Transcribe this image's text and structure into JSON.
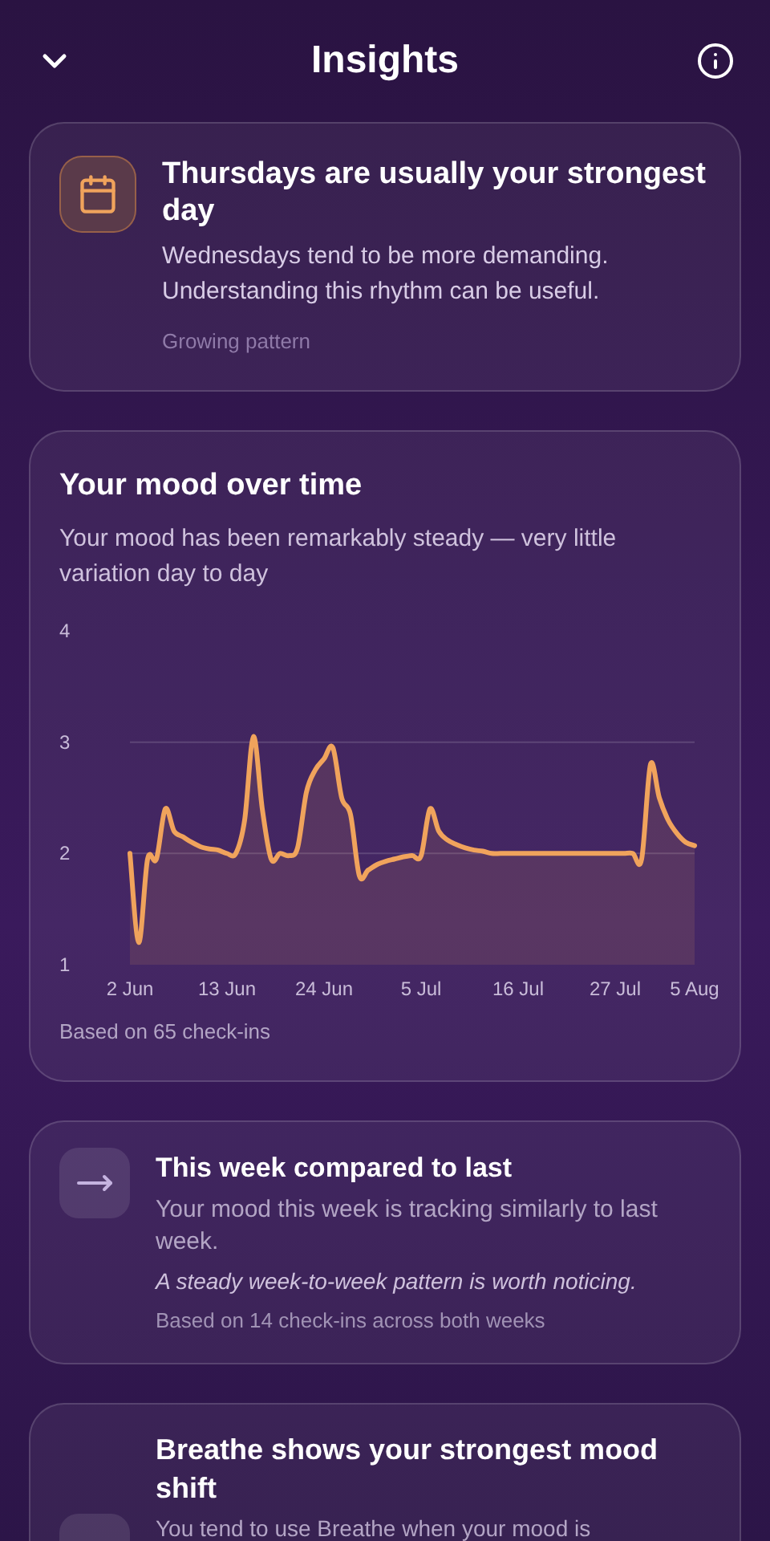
{
  "header": {
    "title": "Insights"
  },
  "pattern_card": {
    "title": "Thursdays are usually your strongest day",
    "body": "Wednesdays tend to be more demanding. Understanding this rhythm can be useful.",
    "tag": "Growing pattern"
  },
  "mood_card": {
    "title": "Your mood over time",
    "subtitle": "Your mood has been remarkably steady — very little variation day to day",
    "footnote": "Based on 65 check-ins",
    "chart_data": {
      "type": "area",
      "categories": [
        "2 Jun",
        null,
        null,
        null,
        null,
        null,
        null,
        null,
        null,
        null,
        null,
        "13 Jun",
        null,
        null,
        null,
        null,
        null,
        null,
        null,
        null,
        null,
        null,
        "24 Jun",
        null,
        null,
        null,
        null,
        null,
        null,
        null,
        null,
        null,
        null,
        "5 Jul",
        null,
        null,
        null,
        null,
        null,
        null,
        null,
        null,
        null,
        null,
        "16 Jul",
        null,
        null,
        null,
        null,
        null,
        null,
        null,
        null,
        null,
        null,
        "27 Jul",
        null,
        null,
        null,
        null,
        null,
        null,
        null,
        null,
        "5 Aug"
      ],
      "series": [
        {
          "color": "#f0a35c",
          "values": [
            2.0,
            1.2,
            1.95,
            1.95,
            2.4,
            2.2,
            2.15,
            2.1,
            2.06,
            2.04,
            2.03,
            2.0,
            2.0,
            2.3,
            3.05,
            2.4,
            1.95,
            2.0,
            1.98,
            2.05,
            2.55,
            2.75,
            2.85,
            2.95,
            2.5,
            2.35,
            1.8,
            1.85,
            1.9,
            1.93,
            1.95,
            1.97,
            1.98,
            1.98,
            2.4,
            2.2,
            2.12,
            2.08,
            2.05,
            2.03,
            2.02,
            2.0,
            2.0,
            2.0,
            2.0,
            2.0,
            2.0,
            2.0,
            2.0,
            2.0,
            2.0,
            2.0,
            2.0,
            2.0,
            2.0,
            2.0,
            2.0,
            2.0,
            1.95,
            2.8,
            2.5,
            2.3,
            2.18,
            2.1,
            2.07
          ]
        }
      ],
      "ylim": [
        1,
        4
      ],
      "yticks": [
        1,
        2,
        3,
        4
      ]
    }
  },
  "compare_card": {
    "title": "This week compared to last",
    "body": "Your mood this week is tracking similarly to last week.",
    "note": "A steady week-to-week pattern is worth noticing.",
    "footnote": "Based on 14 check-ins across both weeks"
  },
  "activity_card": {
    "title": "Breathe shows your strongest mood shift",
    "body": "You tend to use Breathe when your mood is"
  }
}
